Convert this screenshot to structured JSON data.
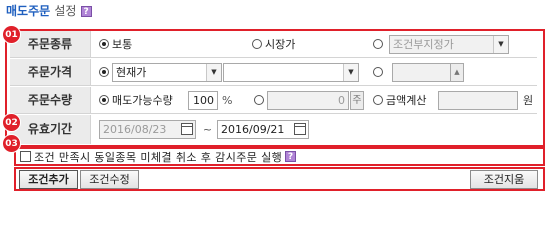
{
  "title": {
    "main": "매도주문",
    "sub": "설정",
    "help": "?"
  },
  "markers": {
    "m1": "01",
    "m2": "02",
    "m3": "03"
  },
  "order_type": {
    "label": "주문종류",
    "opt_normal": "보통",
    "opt_market": "시장가",
    "opt_conditional": "조건부지정가",
    "selected": "보통"
  },
  "order_price": {
    "label": "주문가격",
    "price_type_value": "현재가",
    "second_select_value": "",
    "manual_price_value": ""
  },
  "order_qty": {
    "label": "주문수량",
    "opt_sellable": "매도가능수량",
    "sellable_value": "100",
    "percent_unit": "%",
    "qty_value": "0",
    "qty_unit": "주",
    "opt_amount": "금액계산",
    "amount_value": "",
    "amount_unit": "원"
  },
  "valid_period": {
    "label": "유효기간",
    "start_date": "2016/08/23",
    "separator": "~",
    "end_date": "2016/09/21"
  },
  "option": {
    "text": "조건 만족시 동일종목 미체결 취소 후 감시주문 실행",
    "checked": false,
    "help": "?"
  },
  "buttons": {
    "add": "조건추가",
    "modify": "조건수정",
    "delete": "조건지움"
  },
  "colors": {
    "accent_red": "#e0202a",
    "title_blue": "#1f5fbf",
    "label_bg": "#ebebeb"
  }
}
